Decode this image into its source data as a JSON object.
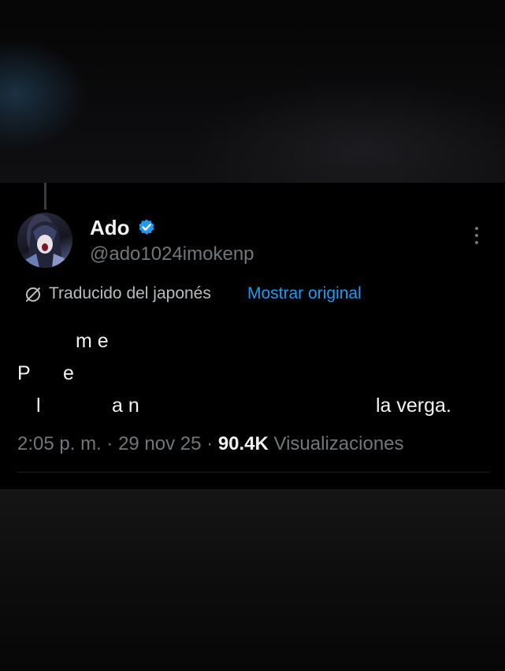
{
  "tweet": {
    "author": {
      "name": "Ado",
      "handle": "@ado1024imokenp",
      "verified_color": "#1d9bf0"
    },
    "translation": {
      "label": "Traducido del japonés",
      "show_original_label": "Mostrar original"
    },
    "body_lines": {
      "line1_fragment": "m e",
      "line2_char1": "P",
      "line2_char2": "e",
      "line3_char1": "l",
      "line3_fragment": "a n",
      "line3_end": "la verga."
    },
    "meta": {
      "time": "2:05 p. m.",
      "separator1": " · ",
      "date": "29 nov 25",
      "separator2": " · ",
      "views_count": "90.4K",
      "views_label": " Visualizaciones"
    },
    "icons": {
      "verified": "verified-badge-icon",
      "more": "more-options-icon",
      "translate": "translate-icon"
    }
  }
}
